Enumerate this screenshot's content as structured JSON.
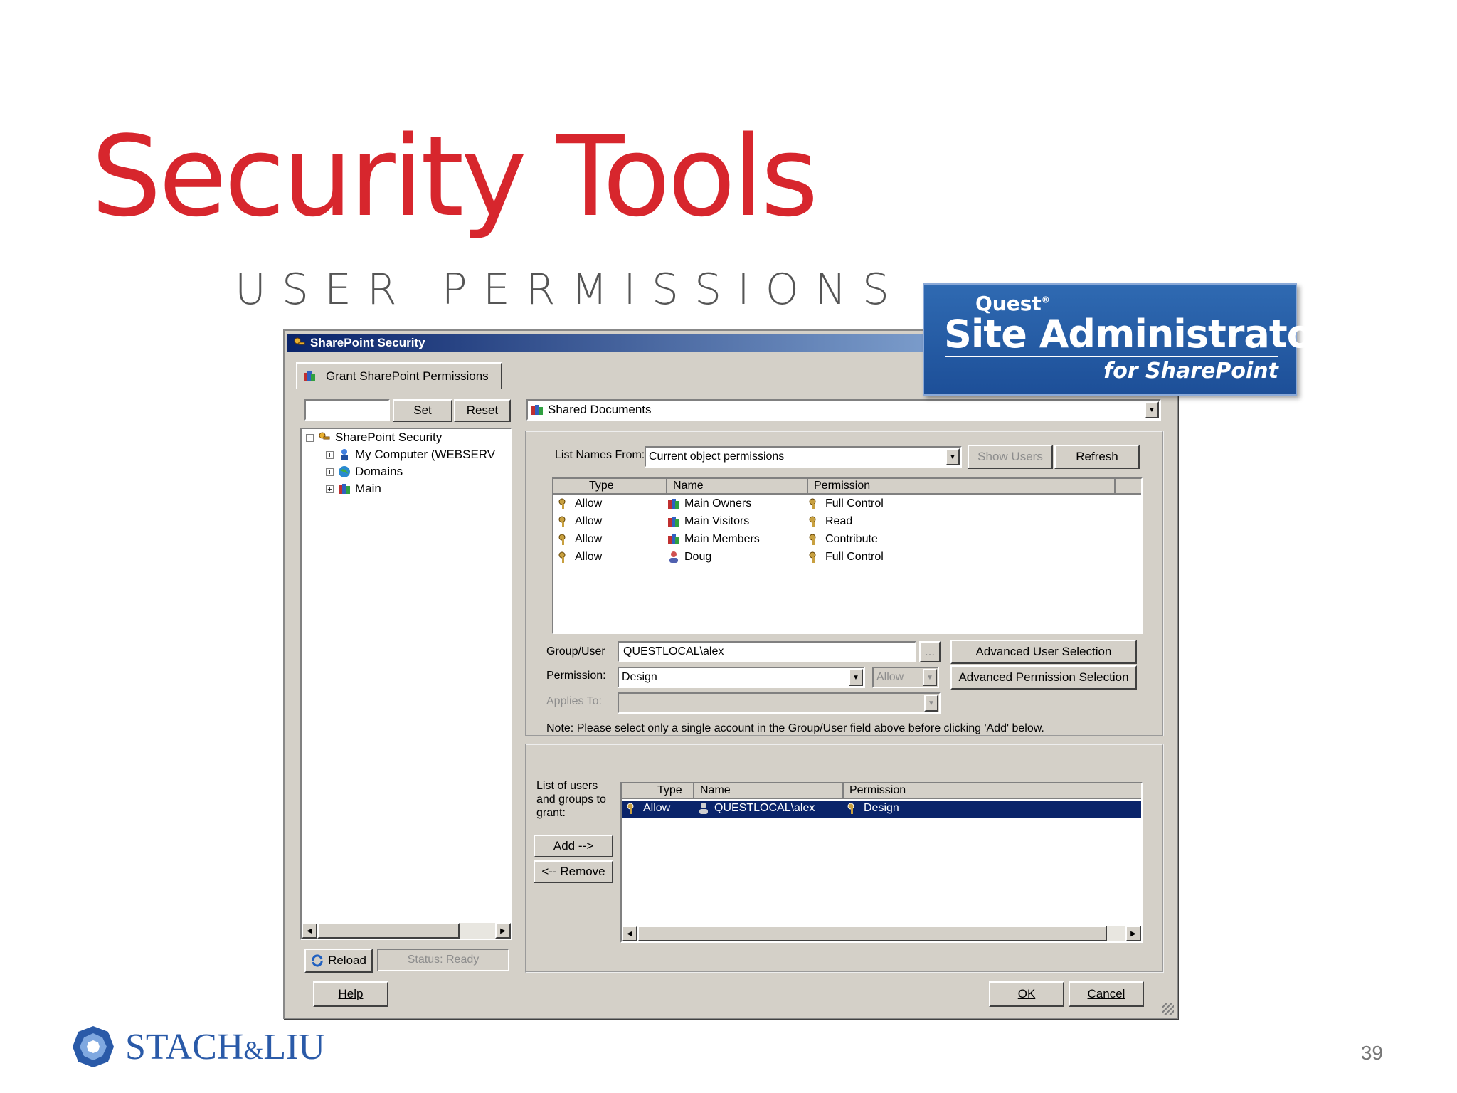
{
  "slide": {
    "title": "Security Tools",
    "subtitle": "USER PERMISSIONS",
    "page_number": "39",
    "footer_logo": {
      "name_a": "STACH",
      "amp": "&",
      "name_b": "LIU"
    }
  },
  "quest_logo": {
    "brand": "Quest",
    "reg": "®",
    "product": "Site Administrator",
    "sub": "for SharePoint"
  },
  "dialog": {
    "title": "SharePoint Security",
    "tab": "Grant SharePoint Permissions",
    "left": {
      "set_label": "Set",
      "reset_label": "Reset",
      "tree": {
        "root": "SharePoint Security",
        "children": [
          "My Computer (WEBSERV",
          "Domains",
          "Main"
        ]
      },
      "reload_label": "Reload",
      "status": "Status: Ready"
    },
    "location": "Shared Documents",
    "list_names_label": "List Names From:",
    "list_names_value": "Current object permissions",
    "show_users_label": "Show Users",
    "refresh_label": "Refresh",
    "perm_table": {
      "headers": [
        "Type",
        "Name",
        "Permission"
      ],
      "rows": [
        {
          "type": "Allow",
          "name": "Main Owners",
          "permission": "Full Control"
        },
        {
          "type": "Allow",
          "name": "Main Visitors",
          "permission": "Read"
        },
        {
          "type": "Allow",
          "name": "Main Members",
          "permission": "Contribute"
        },
        {
          "type": "Allow",
          "name": "Doug",
          "permission": "Full Control"
        }
      ]
    },
    "group_user_label": "Group/User",
    "group_user_value": "QUESTLOCAL\\alex",
    "browse_label": "...",
    "adv_user_label": "Advanced User Selection",
    "permission_label": "Permission:",
    "permission_value": "Design",
    "allow_value": "Allow",
    "adv_perm_label": "Advanced Permission Selection",
    "applies_label": "Applies To:",
    "note": "Note:  Please select only a single account in the Group/User field above before clicking 'Add' below.",
    "grant_list_label": "List of users and groups to grant:",
    "add_label": "Add -->",
    "remove_label": "<-- Remove",
    "grant_table": {
      "headers": [
        "Type",
        "Name",
        "Permission"
      ],
      "rows": [
        {
          "type": "Allow",
          "name": "QUESTLOCAL\\alex",
          "permission": "Design"
        }
      ]
    },
    "help_label": "Help",
    "ok_label": "OK",
    "cancel_label": "Cancel"
  }
}
